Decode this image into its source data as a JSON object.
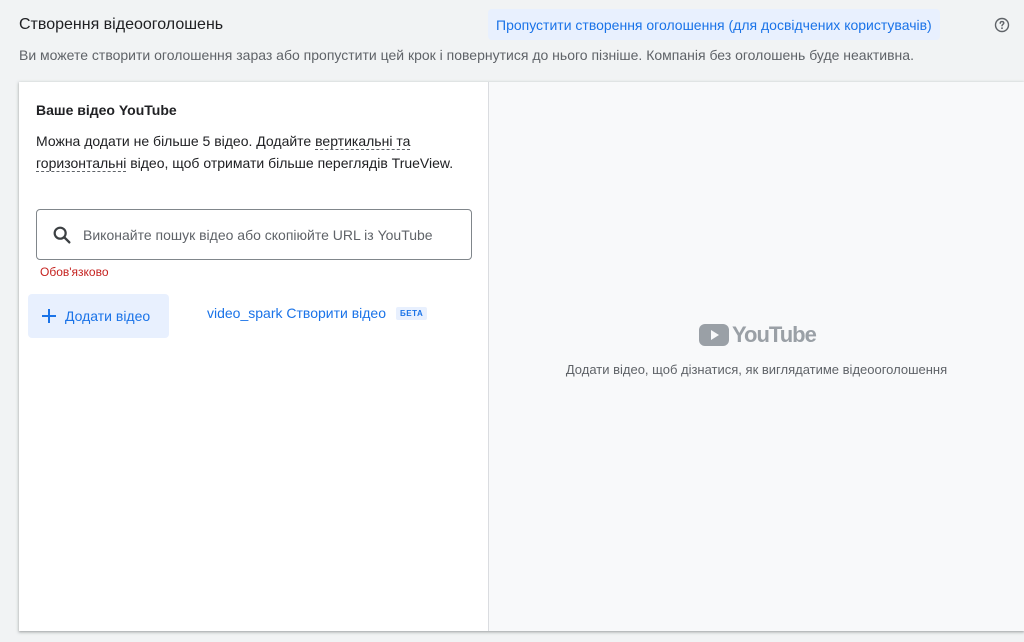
{
  "header": {
    "title": "Створення відеооголошень",
    "skip_link": "Пропустити створення оголошення (для досвідчених користувачів)",
    "subtitle": "Ви можете створити оголошення зараз або пропустити цей крок і повернутися до нього пізніше. Компанія без оголошень буде неактивна."
  },
  "left": {
    "section_title": "Ваше відео YouTube",
    "desc_part1": "Можна додати не більше 5 відео. Додайте ",
    "desc_link1": "вертикальні та горизонтальні",
    "desc_part2": " відео, щоб отримати більше переглядів TrueView.",
    "search_placeholder": "Виконайте пошук відео або скопіюйте URL із YouTube",
    "search_value": "",
    "required": "Обов'язково",
    "add_video": "Додати відео",
    "create_video_prefix": "video_spark",
    "create_video": "Створити відео",
    "beta": "БЕТА"
  },
  "right": {
    "logo_text": "YouTube",
    "hint": "Додати відео, щоб дізнатися, як виглядатиме відеооголошення"
  },
  "icons": {
    "help": "help-circle-icon",
    "search": "search-icon",
    "plus": "plus-icon",
    "youtube": "youtube-play-icon"
  },
  "colors": {
    "accent": "#1a73e8",
    "accent_bg": "#e8f0fe",
    "error": "#c5221f",
    "muted": "#5f6368",
    "logo_gray": "#9aa0a6"
  }
}
